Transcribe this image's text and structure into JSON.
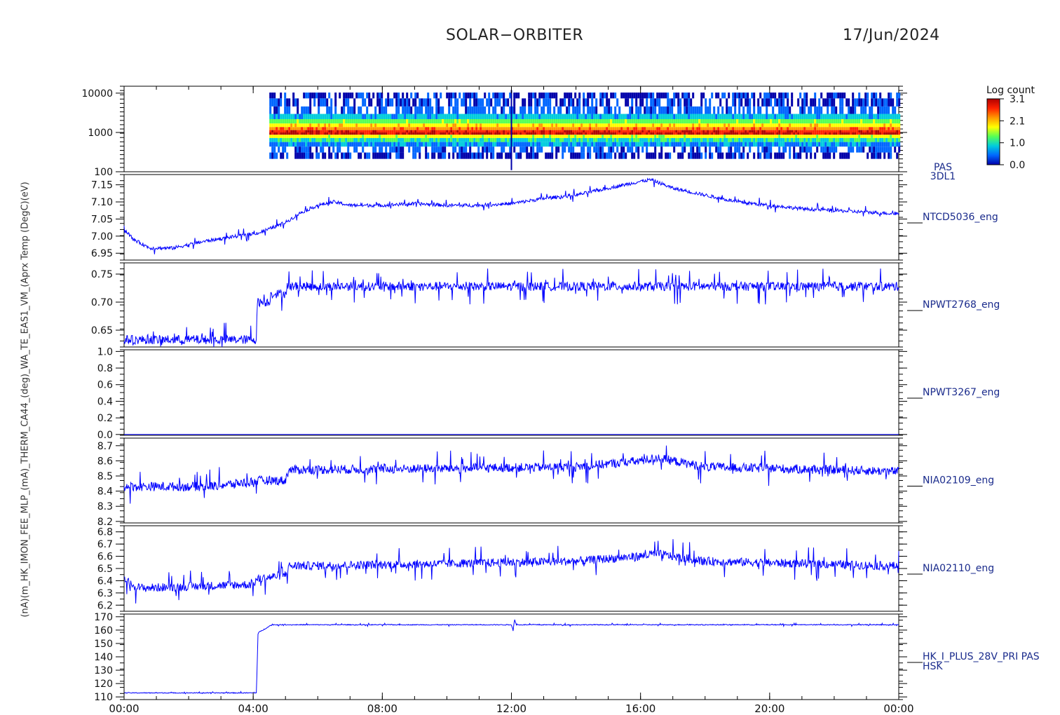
{
  "header": {
    "title": "SOLAR−ORBITER",
    "date": "17/Jun/2024"
  },
  "y_axis_label": "(nA)(m_HK_IMON_FEE_MLP_(mA)_THERM_CA44_(deg)_WA_TE_EAS1_VM_(Aprx Temp (DegC)(eV)",
  "colors": {
    "trace": "#0000ff",
    "axis": "#000000",
    "label": "#1a2b8c"
  },
  "colorbar": {
    "title": "Log count",
    "ticks": [
      "3.1",
      "2.1",
      "1.0",
      "0.0"
    ],
    "stops": [
      "#b00000",
      "#ff2200",
      "#ff9900",
      "#ffff00",
      "#55ff55",
      "#00ccdd",
      "#0066ff",
      "#0000aa"
    ]
  },
  "chart_data": [
    {
      "type": "heatmap",
      "label": "PAS\n3DL1",
      "y_scale": "log",
      "ylim": [
        100,
        15000
      ],
      "yticks": [
        "10000",
        "1000",
        "100"
      ],
      "data_start_hour": 4.5,
      "data_end_hour": 24,
      "bands": [
        {
          "energy": 9000,
          "level": 0.05
        },
        {
          "energy": 6000,
          "level": 0.08
        },
        {
          "energy": 3500,
          "level": 0.12
        },
        {
          "energy": 2500,
          "level": 0.25
        },
        {
          "energy": 1900,
          "level": 0.45
        },
        {
          "energy": 1500,
          "level": 0.6
        },
        {
          "energy": 1250,
          "level": 0.75
        },
        {
          "energy": 1050,
          "level": 0.9
        },
        {
          "energy": 950,
          "level": 0.95
        },
        {
          "energy": 800,
          "level": 0.55
        },
        {
          "energy": 650,
          "level": 0.35
        },
        {
          "energy": 500,
          "level": 0.2
        },
        {
          "energy": 380,
          "level": 0.1
        },
        {
          "energy": 250,
          "level": 0.05
        }
      ]
    },
    {
      "type": "line",
      "label": "NTCD5036_eng",
      "ylim": [
        6.93,
        7.18
      ],
      "yticks": [
        "7.15",
        "7.10",
        "7.05",
        "7.00",
        "6.95"
      ],
      "x": [
        0,
        0.3,
        0.8,
        1.5,
        2.5,
        3.5,
        4.2,
        5,
        5.5,
        6,
        6.5,
        7,
        8,
        9,
        10,
        11,
        12,
        13,
        14,
        15,
        16,
        16.3,
        16.6,
        17,
        18,
        19,
        20,
        21,
        22,
        23,
        24
      ],
      "values": [
        7.02,
        6.99,
        6.965,
        6.965,
        6.985,
        7.0,
        7.01,
        7.04,
        7.07,
        7.09,
        7.1,
        7.09,
        7.09,
        7.095,
        7.09,
        7.09,
        7.095,
        7.11,
        7.12,
        7.14,
        7.16,
        7.165,
        7.155,
        7.14,
        7.12,
        7.1,
        7.09,
        7.08,
        7.075,
        7.07,
        7.065
      ],
      "noise": 0.005
    },
    {
      "type": "line",
      "label": "NPWT2768_eng",
      "ylim": [
        0.62,
        0.77
      ],
      "yticks": [
        "0.75",
        "0.70",
        "0.65"
      ],
      "x": [
        0,
        4.1,
        4.12,
        4.5,
        4.55,
        5.0,
        5.05,
        24
      ],
      "values": [
        0.633,
        0.633,
        0.7,
        0.7,
        0.715,
        0.715,
        0.728,
        0.728
      ],
      "noise": 0.008
    },
    {
      "type": "line",
      "label": "NPWT3267_eng",
      "ylim": [
        -0.01,
        1.02
      ],
      "yticks": [
        "1.0",
        "0.8",
        "0.6",
        "0.4",
        "0.2",
        "0.0"
      ],
      "x": [
        0,
        24
      ],
      "values": [
        0.0,
        0.0
      ],
      "noise": 0.0
    },
    {
      "type": "line",
      "label": "NIA02109_eng",
      "ylim": [
        8.19,
        8.75
      ],
      "yticks": [
        "8.7",
        "8.6",
        "8.5",
        "8.4",
        "8.3",
        "8.2"
      ],
      "x": [
        0,
        2.5,
        3.5,
        4.2,
        5.0,
        5.1,
        10,
        14,
        16,
        16.5,
        18,
        24
      ],
      "values": [
        8.43,
        8.43,
        8.45,
        8.47,
        8.47,
        8.54,
        8.55,
        8.56,
        8.6,
        8.62,
        8.56,
        8.53
      ],
      "noise": 0.03
    },
    {
      "type": "line",
      "label": "NIA02110_eng",
      "ylim": [
        6.15,
        6.85
      ],
      "yticks": [
        "6.8",
        "6.7",
        "6.6",
        "6.5",
        "6.4",
        "6.3",
        "6.2"
      ],
      "x": [
        0,
        0.2,
        0.5,
        4.0,
        4.1,
        5.0,
        5.1,
        10,
        14,
        16,
        16.5,
        18,
        24
      ],
      "values": [
        6.42,
        6.37,
        6.34,
        6.37,
        6.41,
        6.45,
        6.52,
        6.54,
        6.56,
        6.6,
        6.62,
        6.56,
        6.52
      ],
      "noise": 0.035
    },
    {
      "type": "line",
      "label": "HK_I_PLUS_28V_PRI PAS\nHSK",
      "ylim": [
        108,
        172
      ],
      "yticks": [
        "170",
        "160",
        "150",
        "140",
        "130",
        "120",
        "110"
      ],
      "x": [
        0,
        4.1,
        4.15,
        4.3,
        4.5,
        4.6,
        12.0,
        12.05,
        12.1,
        12.15,
        24
      ],
      "values": [
        113,
        113,
        158,
        160,
        163,
        164,
        164,
        160,
        168,
        164,
        164
      ],
      "noise": 0.3
    }
  ],
  "x_axis": {
    "range_hours": [
      0,
      24
    ],
    "ticks": [
      "00:00",
      "04:00",
      "08:00",
      "12:00",
      "16:00",
      "20:00",
      "00:00"
    ]
  }
}
